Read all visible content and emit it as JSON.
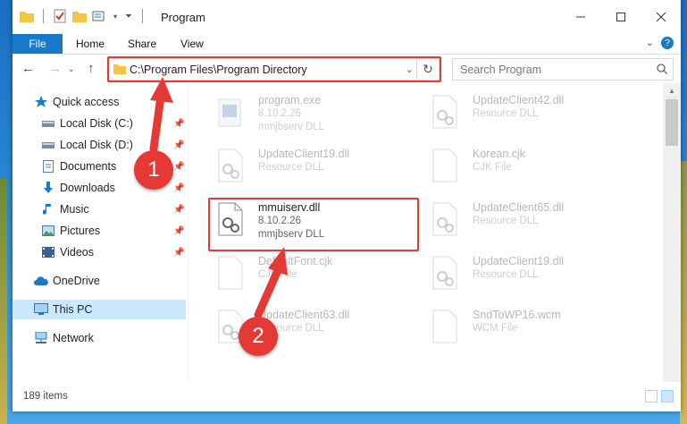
{
  "window": {
    "title": "Program"
  },
  "ribbon": {
    "file": "File",
    "home": "Home",
    "share": "Share",
    "view": "View",
    "help": "?"
  },
  "address": {
    "path": "C:\\Program Files\\Program Directory"
  },
  "search": {
    "placeholder": "Search Program"
  },
  "sidebar": {
    "items": [
      {
        "label": "Quick access",
        "icon": "star-icon"
      },
      {
        "label": "Local Disk (C:)",
        "icon": "drive-icon"
      },
      {
        "label": "Local Disk (D:)",
        "icon": "drive-icon"
      },
      {
        "label": "Documents",
        "icon": "documents-icon"
      },
      {
        "label": "Downloads",
        "icon": "download-icon"
      },
      {
        "label": "Music",
        "icon": "music-icon"
      },
      {
        "label": "Pictures",
        "icon": "pictures-icon"
      },
      {
        "label": "Videos",
        "icon": "videos-icon"
      },
      {
        "label": "OneDrive",
        "icon": "cloud-icon"
      },
      {
        "label": "This PC",
        "icon": "computer-icon"
      },
      {
        "label": "Network",
        "icon": "network-icon"
      }
    ]
  },
  "files": [
    {
      "name": "program.exe",
      "line2": "8.10.2.26",
      "line3": "mmjbserv DLL",
      "icon": "exe-icon"
    },
    {
      "name": "UpdateClient42.dll",
      "line2": "Resource DLL",
      "line3": "",
      "icon": "dll-icon"
    },
    {
      "name": "UpdateClient19.dll",
      "line2": "Resource DLL",
      "line3": "",
      "icon": "dll-icon"
    },
    {
      "name": "Korean.cjk",
      "line2": "CJK File",
      "line3": "",
      "icon": "file-icon"
    },
    {
      "name": "mmuiserv.dll",
      "line2": "8.10.2.26",
      "line3": "mmjbserv DLL",
      "icon": "dll-icon"
    },
    {
      "name": "UpdateClient65.dll",
      "line2": "Resource DLL",
      "line3": "",
      "icon": "dll-icon"
    },
    {
      "name": "DefaultFont.cjk",
      "line2": "CJK File",
      "line3": "",
      "icon": "file-icon"
    },
    {
      "name": "UpdateClient19.dll",
      "line2": "Resource DLL",
      "line3": "",
      "icon": "dll-icon"
    },
    {
      "name": "UpdateClient63.dll",
      "line2": "Resource DLL",
      "line3": "",
      "icon": "dll-icon"
    },
    {
      "name": "SndToWP16.wcm",
      "line2": "WCM File",
      "line3": "",
      "icon": "file-icon"
    }
  ],
  "status": {
    "items": "189 items"
  },
  "annotations": {
    "step1": "1",
    "step2": "2"
  },
  "colors": {
    "accent": "#1979ca",
    "highlight": "#e53935",
    "selection": "#cce8ff"
  }
}
